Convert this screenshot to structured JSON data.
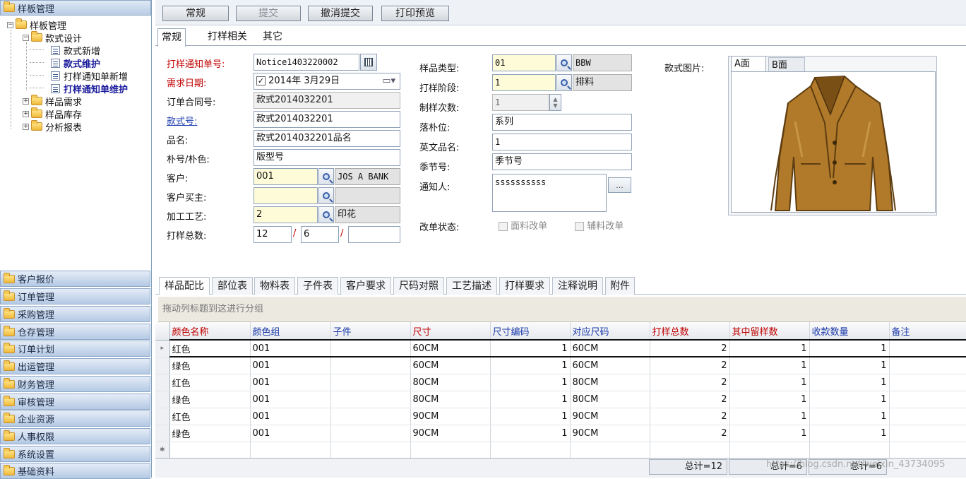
{
  "sidebar": {
    "header": "样板管理",
    "tree": {
      "root": "样板管理",
      "style_design": "款式设计",
      "style_new": "款式新增",
      "style_maintain": "款式维护",
      "notice_new": "打样通知单新增",
      "notice_maintain": "打样通知单维护",
      "sample_demand": "样品需求",
      "sample_stock": "样品库存",
      "analysis_report": "分析报表"
    },
    "modules": [
      "客户报价",
      "订单管理",
      "采购管理",
      "仓存管理",
      "订单计划",
      "出运管理",
      "财务管理",
      "审核管理",
      "企业资源",
      "人事权限",
      "系统设置",
      "基础资料"
    ]
  },
  "toolbar": {
    "normal": "常规",
    "submit": "提交",
    "cancel_submit": "撤消提交",
    "print_preview": "打印预览"
  },
  "form_tabs": [
    "常规",
    "打样相关",
    "其它"
  ],
  "form": {
    "notice_no_label": "打样通知单号:",
    "notice_no_value": "Notice1403220002",
    "demand_date_label": "需求日期:",
    "demand_date_value": "2014年 3月29日",
    "contract_no_label": "订单合同号:",
    "contract_no_value": "款式2014032201",
    "style_no_label": "款式号:",
    "style_no_value": "款式2014032201",
    "product_name_label": "品名:",
    "product_name_value": "款式2014032201品名",
    "pattern_color_label": "朴号/朴色:",
    "pattern_color_value": "版型号",
    "customer_label": "客户:",
    "customer_code": "001",
    "customer_name": "JOS A BANK",
    "customer_buyer_label": "客户买主:",
    "customer_buyer_value": "",
    "process_label": "加工工艺:",
    "process_code": "2",
    "process_name": "印花",
    "total_samples_label": "打样总数:",
    "total_1": "12",
    "total_2": "6",
    "total_3": "",
    "sep": "/",
    "sample_type_label": "样品类型:",
    "sample_type_code": "01",
    "sample_type_name": "BBW",
    "sample_stage_label": "打样阶段:",
    "sample_stage_code": "1",
    "sample_stage_name": "排料",
    "make_times_label": "制样次数:",
    "make_times_value": "1",
    "marker_label": "落朴位:",
    "marker_value": "系列",
    "english_name_label": "英文品名:",
    "english_name_value": "1",
    "season_label": "季节号:",
    "season_value": "季节号",
    "notifier_label": "通知人:",
    "notifier_value": "ssssssssss",
    "more_button": "...",
    "change_status_label": "改单状态:",
    "fabric_change": "面料改单",
    "accessory_change": "辅料改单",
    "style_image_label": "款式图片:",
    "image_tab_a": "A面",
    "image_tab_b": "B面"
  },
  "grid_tabs": [
    "样品配比",
    "部位表",
    "物料表",
    "子件表",
    "客户要求",
    "尺码对照",
    "工艺描述",
    "打样要求",
    "注释说明",
    "附件"
  ],
  "group_hint": "拖动列标题到这进行分组",
  "columns": [
    "颜色名称",
    "颜色组",
    "子件",
    "尺寸",
    "尺寸编码",
    "对应尺码",
    "打样总数",
    "其中留样数",
    "收款数量",
    "备注"
  ],
  "rows": [
    [
      "红色",
      "001",
      "",
      "60CM",
      "1",
      "60CM",
      "2",
      "1",
      "1",
      ""
    ],
    [
      "绿色",
      "001",
      "",
      "60CM",
      "1",
      "60CM",
      "2",
      "1",
      "1",
      ""
    ],
    [
      "红色",
      "001",
      "",
      "80CM",
      "1",
      "80CM",
      "2",
      "1",
      "1",
      ""
    ],
    [
      "绿色",
      "001",
      "",
      "80CM",
      "1",
      "80CM",
      "2",
      "1",
      "1",
      ""
    ],
    [
      "红色",
      "001",
      "",
      "90CM",
      "1",
      "90CM",
      "2",
      "1",
      "1",
      ""
    ],
    [
      "绿色",
      "001",
      "",
      "90CM",
      "1",
      "90CM",
      "2",
      "1",
      "1",
      ""
    ]
  ],
  "footer": {
    "total_samples": "总计=12",
    "total_kept": "总计=6",
    "total_paid": "总计=6"
  },
  "watermark": "https://blog.csdn.net/weixin_43734095",
  "colors": {
    "accent_red": "#c00000",
    "link_blue": "#1f3fb0",
    "required_bg": "#fdfbd8",
    "sidebar_header": "#b9cde5"
  }
}
